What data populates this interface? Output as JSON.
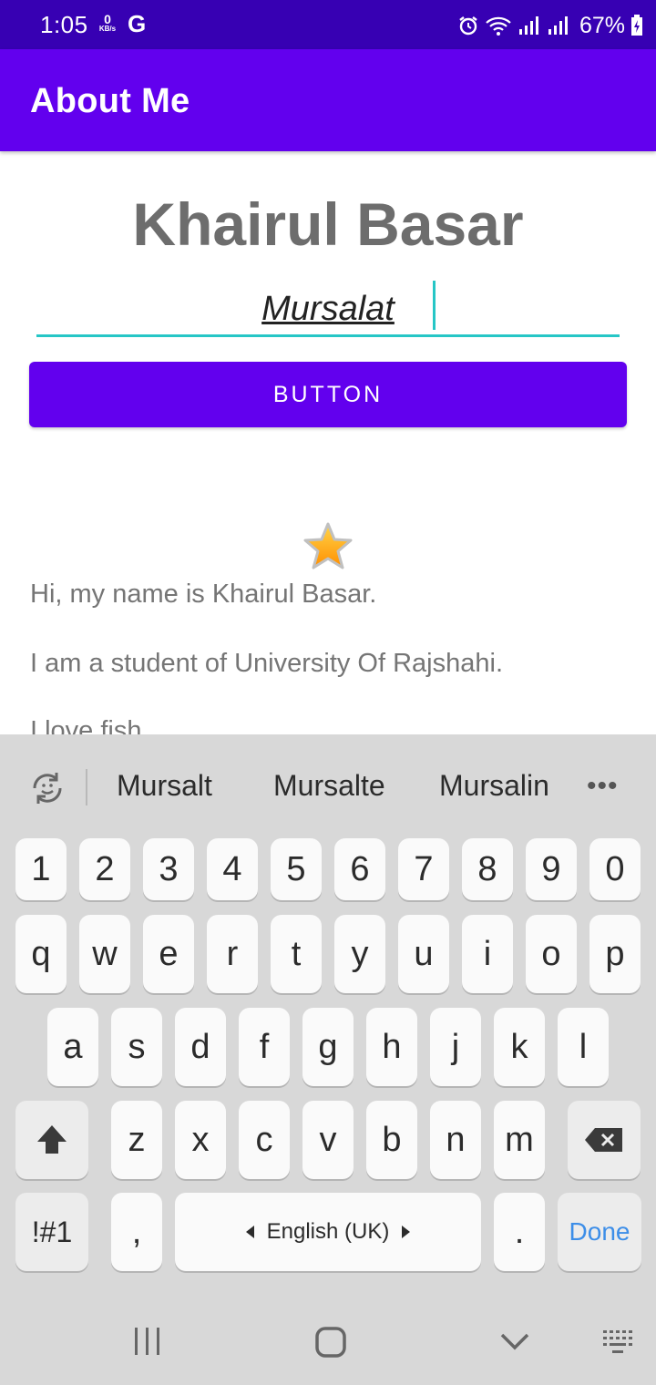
{
  "status_bar": {
    "time": "1:05",
    "net_speed_value": "0",
    "net_speed_unit": "KB/s",
    "carrier_icon": "G",
    "battery": "67%",
    "icons": [
      "alarm-icon",
      "wifi-icon",
      "signal-icon",
      "signal-icon",
      "battery-icon"
    ]
  },
  "app_bar": {
    "title": "About Me"
  },
  "content": {
    "name": "Khairul Basar",
    "nickname_value": "Mursalat",
    "button_label": "BUTTON",
    "star_icon": "star-icon",
    "bio": [
      "Hi, my name is Khairul Basar.",
      "I am a student of University Of Rajshahi.",
      "I love fish."
    ]
  },
  "keyboard": {
    "suggestions": [
      "Mursalt",
      "Mursalte",
      "Mursalin"
    ],
    "more_label": "•••",
    "number_row": [
      "1",
      "2",
      "3",
      "4",
      "5",
      "6",
      "7",
      "8",
      "9",
      "0"
    ],
    "row1": [
      "q",
      "w",
      "e",
      "r",
      "t",
      "y",
      "u",
      "i",
      "o",
      "p"
    ],
    "row2": [
      "a",
      "s",
      "d",
      "f",
      "g",
      "h",
      "j",
      "k",
      "l"
    ],
    "row3": [
      "z",
      "x",
      "c",
      "v",
      "b",
      "n",
      "m"
    ],
    "symbols_label": "!#1",
    "comma_label": ",",
    "space_label": "English (UK)",
    "period_label": ".",
    "done_label": "Done"
  },
  "colors": {
    "status_bar": "#3700b3",
    "primary": "#6200ee",
    "accent": "#26c6c6",
    "done_text": "#3d8ee8"
  }
}
